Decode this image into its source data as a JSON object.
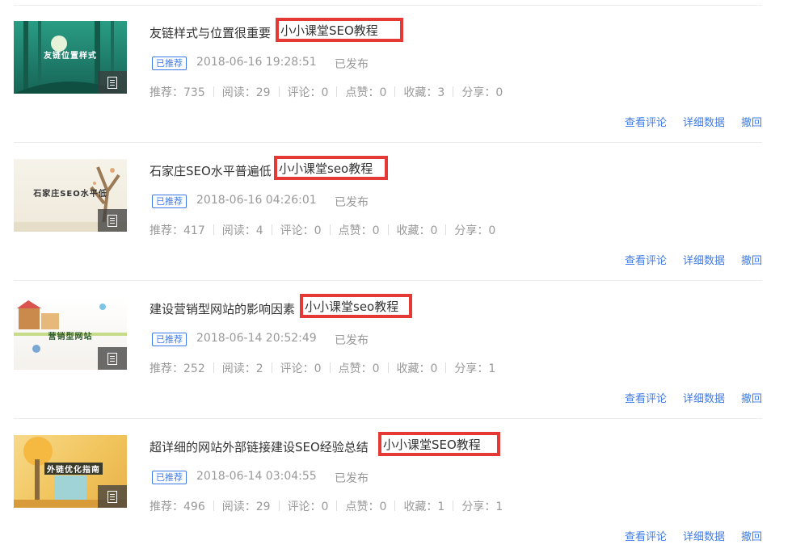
{
  "articles": [
    {
      "title_prefix": "友链样式与位置很重要",
      "highlight": "小小课堂SEO教程",
      "badge": "已推荐",
      "datetime": "2018-06-16 19:28:51",
      "status": "已发布",
      "stats": {
        "recommend": "推荐：735",
        "read": "阅读：29",
        "comment": "评论：0",
        "like": "点赞：0",
        "favorite": "收藏：3",
        "share": "分享：0"
      },
      "thumb_caption": "友链位置样式",
      "actions": {
        "comments": "查看评论",
        "details": "详细数据",
        "revoke": "撤回"
      }
    },
    {
      "title_prefix": "石家庄SEO水平普遍低",
      "highlight": "小小课堂seo教程",
      "badge": "已推荐",
      "datetime": "2018-06-16 04:26:01",
      "status": "已发布",
      "stats": {
        "recommend": "推荐：417",
        "read": "阅读：4",
        "comment": "评论：0",
        "like": "点赞：0",
        "favorite": "收藏：0",
        "share": "分享：0"
      },
      "thumb_caption": "石家庄SEO水平低",
      "actions": {
        "comments": "查看评论",
        "details": "详细数据",
        "revoke": "撤回"
      }
    },
    {
      "title_prefix": "建设营销型网站的影响因素",
      "highlight": "小小课堂seo教程",
      "badge": "已推荐",
      "datetime": "2018-06-14 20:52:49",
      "status": "已发布",
      "stats": {
        "recommend": "推荐：252",
        "read": "阅读：2",
        "comment": "评论：0",
        "like": "点赞：0",
        "favorite": "收藏：0",
        "share": "分享：1"
      },
      "thumb_caption": "营销型网站",
      "actions": {
        "comments": "查看评论",
        "details": "详细数据",
        "revoke": "撤回"
      }
    },
    {
      "title_prefix": "超详细的网站外部链接建设SEO经验总结",
      "highlight": "小小课堂SEO教程",
      "badge": "已推荐",
      "datetime": "2018-06-14 03:04:55",
      "status": "已发布",
      "stats": {
        "recommend": "推荐：496",
        "read": "阅读：29",
        "comment": "评论：0",
        "like": "点赞：0",
        "favorite": "收藏：1",
        "share": "分享：1"
      },
      "thumb_caption": "外链优化指南",
      "actions": {
        "comments": "查看评论",
        "details": "详细数据",
        "revoke": "撤回"
      }
    }
  ],
  "colors": {
    "accent": "#3e7be8",
    "highlight_border": "#e53935"
  }
}
